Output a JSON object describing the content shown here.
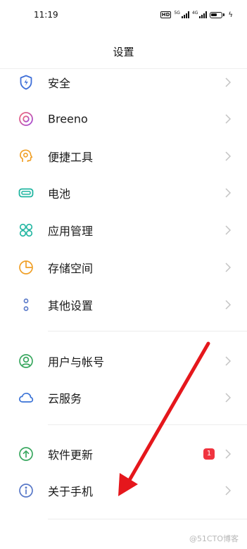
{
  "status_bar": {
    "time": "11:19",
    "hd": "HD",
    "sig1_label": "5G",
    "sig2_label": "4G"
  },
  "header": {
    "title": "设置"
  },
  "items": [
    {
      "label": "安全",
      "icon": "shield-icon",
      "color": "#3f6fd8"
    },
    {
      "label": "Breeno",
      "icon": "breeno-icon",
      "color": "#e04b8e"
    },
    {
      "label": "便捷工具",
      "icon": "tools-icon",
      "color": "#f0a028"
    },
    {
      "label": "电池",
      "icon": "battery-icon",
      "color": "#1fb5a0"
    },
    {
      "label": "应用管理",
      "icon": "apps-icon",
      "color": "#1fb5a0"
    },
    {
      "label": "存储空间",
      "icon": "storage-icon",
      "color": "#f0a028"
    },
    {
      "label": "其他设置",
      "icon": "more-settings-icon",
      "color": "#5878c8"
    },
    {
      "label": "用户与帐号",
      "icon": "user-icon",
      "color": "#3aa860"
    },
    {
      "label": "云服务",
      "icon": "cloud-icon",
      "color": "#3a72d6"
    },
    {
      "label": "软件更新",
      "icon": "update-icon",
      "color": "#3aa860",
      "badge": "1"
    },
    {
      "label": "关于手机",
      "icon": "info-icon",
      "color": "#5878c8"
    }
  ],
  "annotation": {
    "arrow_color": "#e5171c"
  },
  "watermark": "@51CTO博客"
}
